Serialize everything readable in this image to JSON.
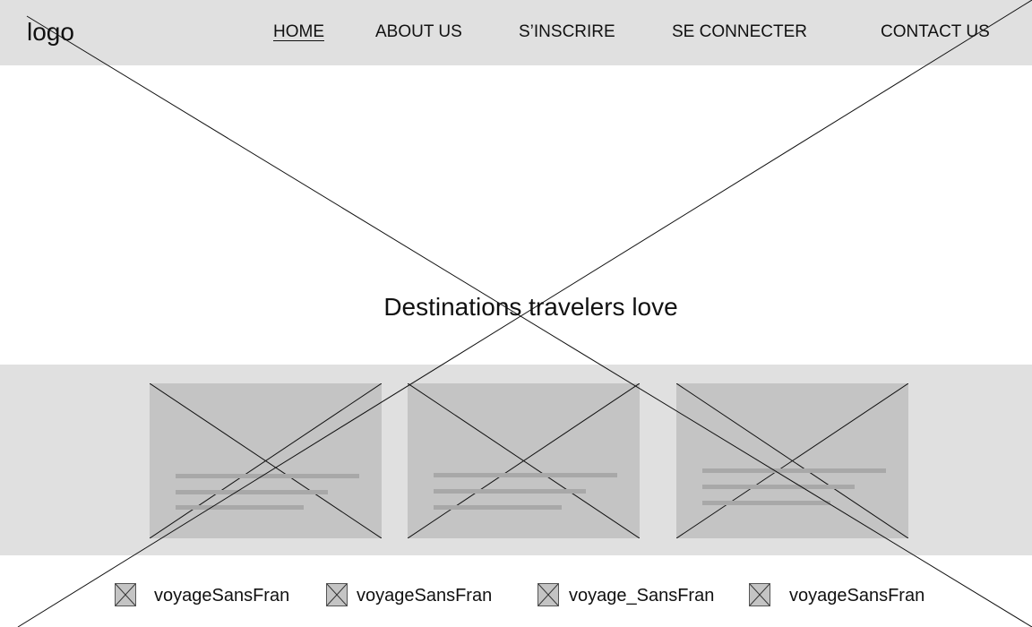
{
  "header": {
    "logo": "logo",
    "nav": [
      {
        "label": "HOME",
        "active": true
      },
      {
        "label": "ABOUT US",
        "active": false
      },
      {
        "label": "S’INSCRIRE",
        "active": false
      },
      {
        "label": "SE CONNECTER",
        "active": false
      },
      {
        "label": "CONTACT US",
        "active": false
      }
    ]
  },
  "hero": {
    "title": "Destinations travelers love"
  },
  "cards": [
    {
      "icon": "image-placeholder-icon"
    },
    {
      "icon": "image-placeholder-icon"
    },
    {
      "icon": "image-placeholder-icon"
    }
  ],
  "footer": {
    "items": [
      {
        "label": "voyageSansFran",
        "icon": "image-placeholder-icon"
      },
      {
        "label": "voyageSansFran",
        "icon": "image-placeholder-icon"
      },
      {
        "label": "voyage_SansFran",
        "icon": "image-placeholder-icon"
      },
      {
        "label": "voyageSansFran",
        "icon": "image-placeholder-icon"
      }
    ]
  },
  "colors": {
    "header_bg": "#e0e0e0",
    "band_bg": "#e0e0e0",
    "placeholder_fill": "#c4c4c4",
    "placeholder_line": "#a8a8a8"
  }
}
